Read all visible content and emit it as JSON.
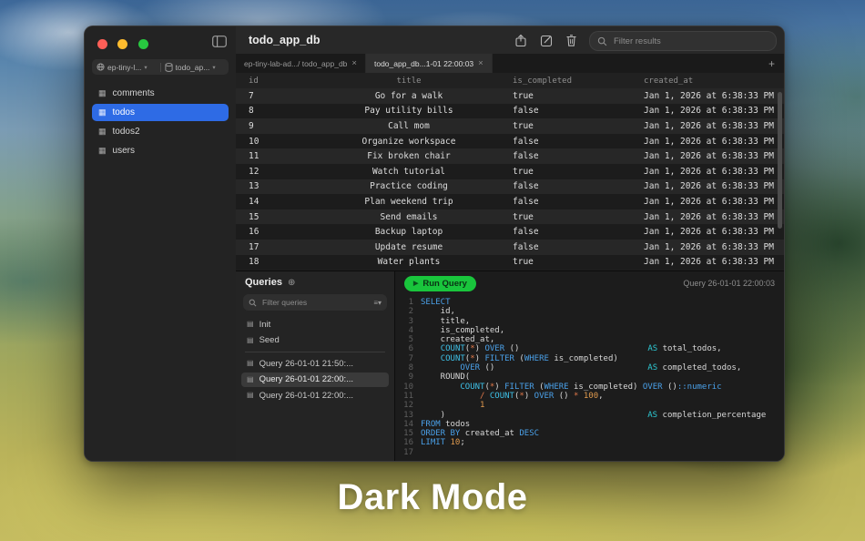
{
  "caption": "Dark Mode",
  "icons": {
    "table": "▦",
    "document": "▤",
    "chevron_down": "▾",
    "plus_circle": "⊕",
    "play": "▶",
    "close": "×",
    "add": "+",
    "menu": "≡"
  },
  "colors": {
    "accent_blue": "#2e6be5",
    "run_green": "#19c53c",
    "traffic_red": "#ff5f57",
    "traffic_yellow": "#febc2e",
    "traffic_green": "#28c840"
  },
  "window": {
    "sidebar": {
      "connection_label": "ep-tiny-l...",
      "database_label": "todo_ap...",
      "items": [
        {
          "label": "comments",
          "selected": false
        },
        {
          "label": "todos",
          "selected": true
        },
        {
          "label": "todos2",
          "selected": false
        },
        {
          "label": "users",
          "selected": false
        }
      ]
    },
    "titlebar": {
      "title": "todo_app_db",
      "search_placeholder": "Filter results"
    },
    "tabs": [
      {
        "label": "ep-tiny-lab-ad.../ todo_app_db",
        "active": false
      },
      {
        "label": "todo_app_db...1-01 22:00:03",
        "active": true
      }
    ],
    "table": {
      "columns": [
        "id",
        "title",
        "is_completed",
        "created_at"
      ],
      "rows": [
        [
          "7",
          "Go for a walk",
          "true",
          "Jan 1, 2026 at 6:38:33 PM"
        ],
        [
          "8",
          "Pay utility bills",
          "false",
          "Jan 1, 2026 at 6:38:33 PM"
        ],
        [
          "9",
          "Call mom",
          "true",
          "Jan 1, 2026 at 6:38:33 PM"
        ],
        [
          "10",
          "Organize workspace",
          "false",
          "Jan 1, 2026 at 6:38:33 PM"
        ],
        [
          "11",
          "Fix broken chair",
          "false",
          "Jan 1, 2026 at 6:38:33 PM"
        ],
        [
          "12",
          "Watch tutorial",
          "true",
          "Jan 1, 2026 at 6:38:33 PM"
        ],
        [
          "13",
          "Practice coding",
          "false",
          "Jan 1, 2026 at 6:38:33 PM"
        ],
        [
          "14",
          "Plan weekend trip",
          "false",
          "Jan 1, 2026 at 6:38:33 PM"
        ],
        [
          "15",
          "Send emails",
          "true",
          "Jan 1, 2026 at 6:38:33 PM"
        ],
        [
          "16",
          "Backup laptop",
          "false",
          "Jan 1, 2026 at 6:38:33 PM"
        ],
        [
          "17",
          "Update resume",
          "false",
          "Jan 1, 2026 at 6:38:33 PM"
        ],
        [
          "18",
          "Water plants",
          "true",
          "Jan 1, 2026 at 6:38:33 PM"
        ]
      ]
    },
    "queries": {
      "title": "Queries",
      "filter_placeholder": "Filter queries",
      "divider_before_index": 2,
      "items": [
        {
          "label": "Init",
          "selected": false
        },
        {
          "label": "Seed",
          "selected": false
        },
        {
          "label": "Query 26-01-01 21:50:...",
          "selected": false
        },
        {
          "label": "Query 26-01-01 22:00:...",
          "selected": true
        },
        {
          "label": "Query 26-01-01 22:00:...",
          "selected": false
        }
      ]
    },
    "editor": {
      "run_label": "Run Query",
      "query_label": "Query 26-01-01 22:00:03",
      "code_lines": [
        [
          [
            "kw",
            "SELECT"
          ]
        ],
        [
          [
            "pl",
            "    id,"
          ]
        ],
        [
          [
            "pl",
            "    title,"
          ]
        ],
        [
          [
            "pl",
            "    is_completed,"
          ]
        ],
        [
          [
            "pl",
            "    created_at,"
          ]
        ],
        [
          [
            "pl",
            "    "
          ],
          [
            "fn",
            "COUNT"
          ],
          [
            "pl",
            "("
          ],
          [
            "op",
            "*"
          ],
          [
            "pl",
            ") "
          ],
          [
            "kw",
            "OVER"
          ],
          [
            "pl",
            " ()"
          ],
          [
            "pl",
            "                          "
          ],
          [
            "as",
            "AS"
          ],
          [
            "pl",
            " total_todos,"
          ]
        ],
        [
          [
            "pl",
            "    "
          ],
          [
            "fn",
            "COUNT"
          ],
          [
            "pl",
            "("
          ],
          [
            "op",
            "*"
          ],
          [
            "pl",
            ") "
          ],
          [
            "kw",
            "FILTER"
          ],
          [
            "pl",
            " ("
          ],
          [
            "kw",
            "WHERE"
          ],
          [
            "pl",
            " is_completed)"
          ]
        ],
        [
          [
            "pl",
            "        "
          ],
          [
            "kw",
            "OVER"
          ],
          [
            "pl",
            " ()"
          ],
          [
            "pl",
            "                               "
          ],
          [
            "as",
            "AS"
          ],
          [
            "pl",
            " completed_todos,"
          ]
        ],
        [
          [
            "pl",
            "    ROUND("
          ]
        ],
        [
          [
            "pl",
            "        "
          ],
          [
            "fn",
            "COUNT"
          ],
          [
            "pl",
            "("
          ],
          [
            "op",
            "*"
          ],
          [
            "pl",
            ") "
          ],
          [
            "kw",
            "FILTER"
          ],
          [
            "pl",
            " ("
          ],
          [
            "kw",
            "WHERE"
          ],
          [
            "pl",
            " is_completed) "
          ],
          [
            "kw",
            "OVER"
          ],
          [
            "pl",
            " ()"
          ],
          [
            "kw",
            "::numeric"
          ]
        ],
        [
          [
            "pl",
            "            "
          ],
          [
            "op",
            "/"
          ],
          [
            "pl",
            " "
          ],
          [
            "fn",
            "COUNT"
          ],
          [
            "pl",
            "("
          ],
          [
            "op",
            "*"
          ],
          [
            "pl",
            ") "
          ],
          [
            "kw",
            "OVER"
          ],
          [
            "pl",
            " () "
          ],
          [
            "op",
            "*"
          ],
          [
            "pl",
            " "
          ],
          [
            "num",
            "100"
          ],
          [
            "pl",
            ","
          ]
        ],
        [
          [
            "pl",
            "            "
          ],
          [
            "num",
            "1"
          ]
        ],
        [
          [
            "pl",
            "    )"
          ],
          [
            "pl",
            "                                         "
          ],
          [
            "as",
            "AS"
          ],
          [
            "pl",
            " completion_percentage"
          ]
        ],
        [
          [
            "kw",
            "FROM"
          ],
          [
            "pl",
            " todos"
          ]
        ],
        [
          [
            "kw",
            "ORDER BY"
          ],
          [
            "pl",
            " created_at "
          ],
          [
            "kw",
            "DESC"
          ]
        ],
        [
          [
            "kw",
            "LIMIT"
          ],
          [
            "pl",
            " "
          ],
          [
            "num",
            "10"
          ],
          [
            "pl",
            ";"
          ]
        ],
        []
      ]
    }
  }
}
